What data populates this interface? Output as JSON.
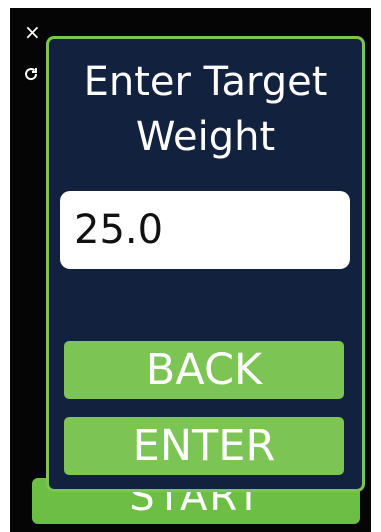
{
  "modal": {
    "title": "Enter Target\nWeight",
    "input_value": "25.0",
    "back_label": "BACK",
    "enter_label": "ENTER"
  },
  "background": {
    "close_glyph": "×",
    "refresh_icon": "refresh-icon",
    "start_label": "START"
  },
  "colors": {
    "modal_bg": "#12213d",
    "accent_green": "#7cc453",
    "screen_bg": "#050505"
  }
}
